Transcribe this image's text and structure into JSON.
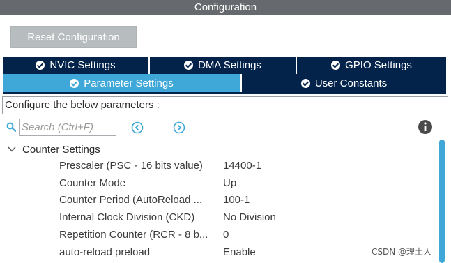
{
  "title": "Configuration",
  "reset_button": "Reset Configuration",
  "tabs_row1": [
    {
      "label": "NVIC Settings"
    },
    {
      "label": "DMA Settings"
    },
    {
      "label": "GPIO Settings"
    }
  ],
  "tabs_row2": [
    {
      "label": "Parameter Settings",
      "active": true
    },
    {
      "label": "User Constants"
    }
  ],
  "description": "Configure the below parameters :",
  "search": {
    "placeholder": "Search (Ctrl+F)",
    "value": ""
  },
  "group": {
    "label": "Counter Settings",
    "expanded": true,
    "params": [
      {
        "name": "Prescaler (PSC - 16 bits value)",
        "value": "14400-1"
      },
      {
        "name": "Counter Mode",
        "value": "Up"
      },
      {
        "name": "Counter Period (AutoReload ...",
        "value": "100-1"
      },
      {
        "name": "Internal Clock Division (CKD)",
        "value": "No Division"
      },
      {
        "name": "Repetition Counter (RCR - 8 b...",
        "value": "0"
      },
      {
        "name": "auto-reload preload",
        "value": "Enable"
      }
    ]
  },
  "watermark": "CSDN @理土人",
  "colors": {
    "titlebar": "#666a6e",
    "tab_dark": "#03234b",
    "tab_active": "#3fa8d8",
    "reset_button": "#b7bcbf",
    "icon_blue": "#3fa8d8"
  }
}
